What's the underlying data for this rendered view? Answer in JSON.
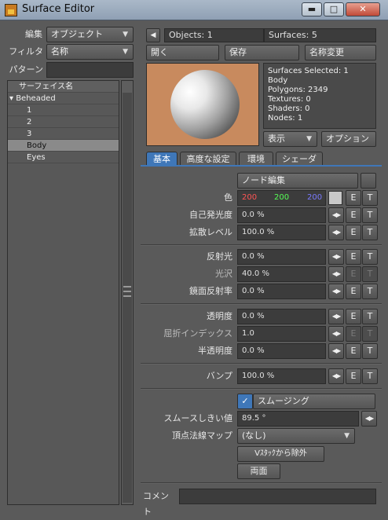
{
  "window": {
    "title": "Surface Editor",
    "minimize": "▬",
    "maximize": "□",
    "close": "✕"
  },
  "left": {
    "edit_label": "編集",
    "edit_value": "オブジェクト",
    "filter_label": "フィルタ",
    "filter_value": "名称",
    "pattern_label": "パターン",
    "pattern_value": "",
    "list_header": "サーフェイス名",
    "items": [
      {
        "label": "▾ Beheaded"
      },
      {
        "label": "1"
      },
      {
        "label": "2"
      },
      {
        "label": "3"
      },
      {
        "label": "Body"
      },
      {
        "label": "Eyes"
      }
    ]
  },
  "header": {
    "back_icon": "◀",
    "objects": "Objects: 1",
    "surfaces": "Surfaces: 5",
    "open": "開く",
    "save": "保存",
    "rename": "名称変更"
  },
  "info": {
    "lines": [
      "Surfaces Selected: 1",
      "Body",
      "Polygons: 2349",
      "Textures: 0",
      "Shaders: 0",
      "Nodes: 1"
    ],
    "display": "表示",
    "options": "オプション"
  },
  "tabs": [
    "基本",
    "高度な設定",
    "環境",
    "シェーダ"
  ],
  "basic": {
    "node_edit": "ノード編集",
    "color_label": "色",
    "color_r": "200",
    "color_g": "200",
    "color_b": "200",
    "luminosity_label": "自己発光度",
    "luminosity": "0.0 %",
    "diffuse_label": "拡散レベル",
    "diffuse": "100.0 %",
    "specular_label": "反射光",
    "specular": "0.0 %",
    "gloss_label": "光沢",
    "gloss": "40.0 %",
    "reflection_label": "鏡面反射率",
    "reflection": "0.0 %",
    "transparency_label": "透明度",
    "transparency": "0.0 %",
    "refraction_label": "屈折インデックス",
    "refraction": "1.0",
    "translucency_label": "半透明度",
    "translucency": "0.0 %",
    "bump_label": "バンプ",
    "bump": "100.0 %",
    "smoothing_check": "✓",
    "smoothing": "スムージング",
    "smooth_threshold_label": "スムースしきい値",
    "smooth_threshold": "89.5 °",
    "vertex_map_label": "頂点法線マップ",
    "vertex_map": "(なし)",
    "exclude_vstack": "Vｽﾀｯｸから除外",
    "double_sided": "両面",
    "comment_label": "コメント",
    "comment": "",
    "env_btn": "E",
    "tex_btn": "T",
    "arrow_btn": "◀▶"
  },
  "colors": {
    "accent": "#3f77b8",
    "red": "#ff5555",
    "green": "#55ff55",
    "blue": "#6f6fff"
  }
}
